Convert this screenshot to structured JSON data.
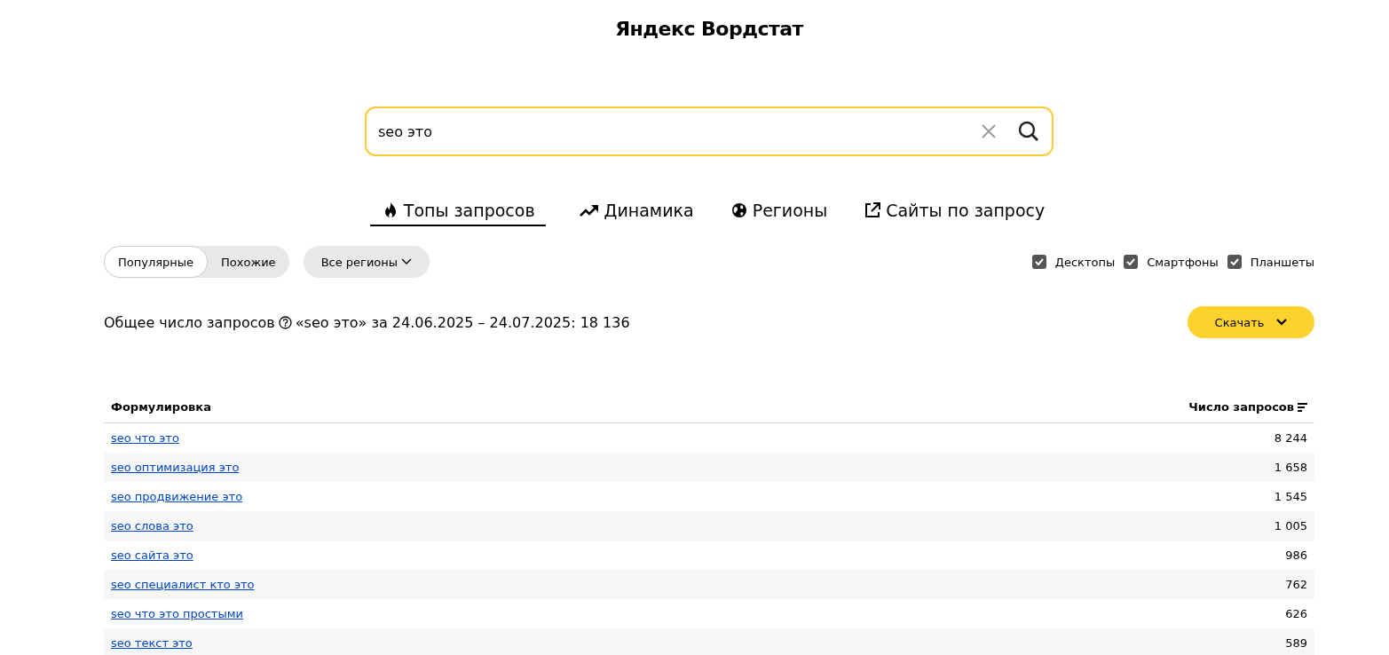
{
  "title": "Яндекс Вордстат",
  "search": {
    "value": "seo это"
  },
  "tabs": [
    {
      "label": "Топы запросов",
      "kind": "fire",
      "selected": true
    },
    {
      "label": "Динамика",
      "kind": "trend",
      "selected": false
    },
    {
      "label": "Регионы",
      "kind": "globe",
      "selected": false
    },
    {
      "label": "Сайты по запросу",
      "kind": "external",
      "selected": false
    }
  ],
  "mode_switch": [
    {
      "label": "Популярные",
      "selected": true
    },
    {
      "label": "Похожие",
      "selected": false
    }
  ],
  "region_select": {
    "label": "Все регионы"
  },
  "devices": [
    {
      "label": "Десктопы",
      "checked": true
    },
    {
      "label": "Смартфоны",
      "checked": true
    },
    {
      "label": "Планшеты",
      "checked": true
    }
  ],
  "total": {
    "label": "Общее число запросов",
    "text": "«seo это» за 24.06.2025 – 24.07.2025: 18 136"
  },
  "download_button": {
    "label": "Скачать"
  },
  "table": {
    "columns": [
      "Формулировка",
      "Число запросов"
    ],
    "rows": [
      {
        "phrase": "seo что это",
        "count": "8 244"
      },
      {
        "phrase": "seo оптимизация это",
        "count": "1 658"
      },
      {
        "phrase": "seo продвижение это",
        "count": "1 545"
      },
      {
        "phrase": "seo слова это",
        "count": "1 005"
      },
      {
        "phrase": "seo сайта это",
        "count": "986"
      },
      {
        "phrase": "seo специалист кто это",
        "count": "762"
      },
      {
        "phrase": "seo что это простыми",
        "count": "626"
      },
      {
        "phrase": "seo текст это",
        "count": "589"
      }
    ]
  }
}
